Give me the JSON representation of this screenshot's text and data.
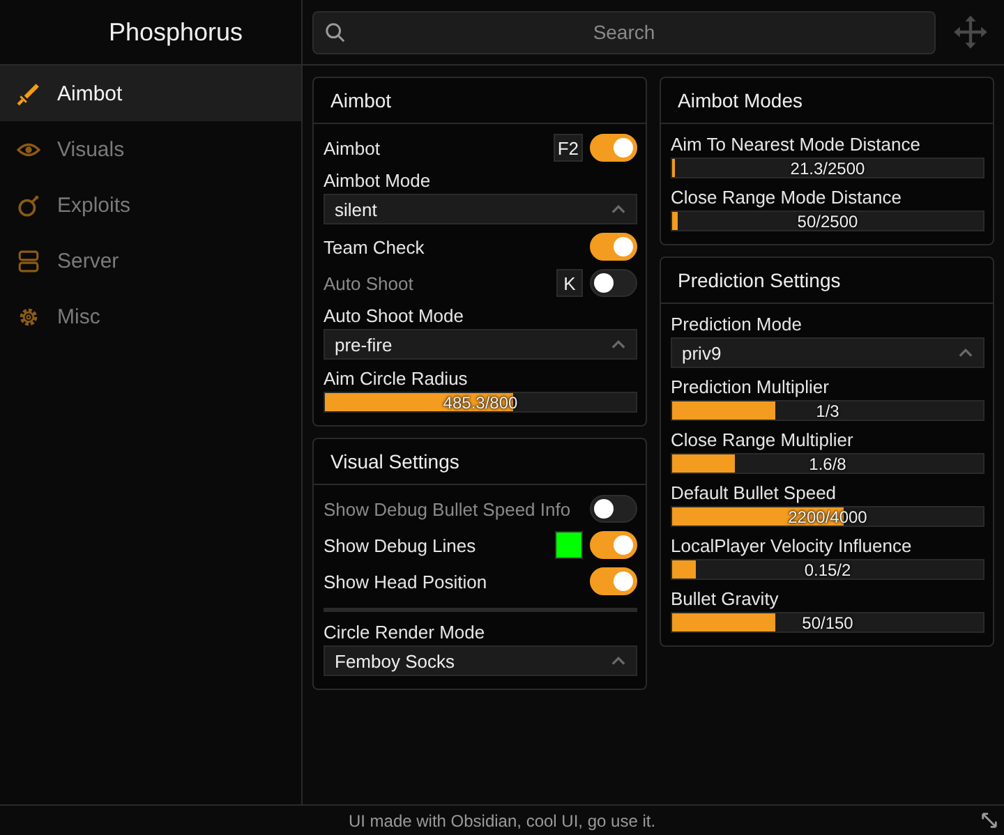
{
  "window": {
    "title": "Phosphorus"
  },
  "sidebar": {
    "items": [
      {
        "label": "Aimbot",
        "selected": true
      },
      {
        "label": "Visuals",
        "selected": false
      },
      {
        "label": "Exploits",
        "selected": false
      },
      {
        "label": "Server",
        "selected": false
      },
      {
        "label": "Misc",
        "selected": false
      }
    ]
  },
  "search": {
    "placeholder": "Search"
  },
  "columns": [
    [
      {
        "title": "Aimbot",
        "items": [
          {
            "kind": "toggle",
            "label": "Aimbot",
            "keybind": "F2",
            "on": true
          },
          {
            "kind": "dropdown",
            "label": "Aimbot Mode",
            "value": "silent"
          },
          {
            "kind": "toggle",
            "label": "Team Check",
            "on": true
          },
          {
            "kind": "toggle",
            "label": "Auto Shoot",
            "keybind": "K",
            "on": false
          },
          {
            "kind": "dropdown",
            "label": "Auto Shoot Mode",
            "value": "pre-fire"
          },
          {
            "kind": "slider",
            "label": "Aim Circle Radius",
            "reading": "485.3/800",
            "level": 0.607
          }
        ]
      },
      {
        "title": "Visual Settings",
        "items": [
          {
            "kind": "toggle",
            "label": "Show Debug Bullet Speed Info",
            "on": false
          },
          {
            "kind": "toggle",
            "label": "Show Debug Lines",
            "color": "#00ff00",
            "on": true
          },
          {
            "kind": "toggle",
            "label": "Show Head Position",
            "on": true
          },
          {
            "kind": "divider"
          },
          {
            "kind": "dropdown",
            "label": "Circle Render Mode",
            "value": "Femboy Socks"
          }
        ]
      }
    ],
    [
      {
        "title": "Aimbot Modes",
        "items": [
          {
            "kind": "slider",
            "label": "Aim To Nearest Mode Distance",
            "reading": "21.3/2500",
            "level": 0.0085
          },
          {
            "kind": "slider",
            "label": "Close Range Mode Distance",
            "reading": "50/2500",
            "level": 0.02
          }
        ]
      },
      {
        "title": "Prediction Settings",
        "items": [
          {
            "kind": "dropdown",
            "label": "Prediction Mode",
            "value": "priv9"
          },
          {
            "kind": "slider",
            "label": "Prediction Multiplier",
            "reading": "1/3",
            "level": 0.333
          },
          {
            "kind": "slider",
            "label": "Close Range Multiplier",
            "reading": "1.6/8",
            "level": 0.2
          },
          {
            "kind": "slider",
            "label": "Default Bullet Speed",
            "reading": "2200/4000",
            "level": 0.55
          },
          {
            "kind": "slider",
            "label": "LocalPlayer Velocity Influence",
            "reading": "0.15/2",
            "level": 0.075
          },
          {
            "kind": "slider",
            "label": "Bullet Gravity",
            "reading": "50/150",
            "level": 0.333
          }
        ]
      }
    ]
  ],
  "status_bar": "UI made with Obsidian, cool UI, go use it."
}
